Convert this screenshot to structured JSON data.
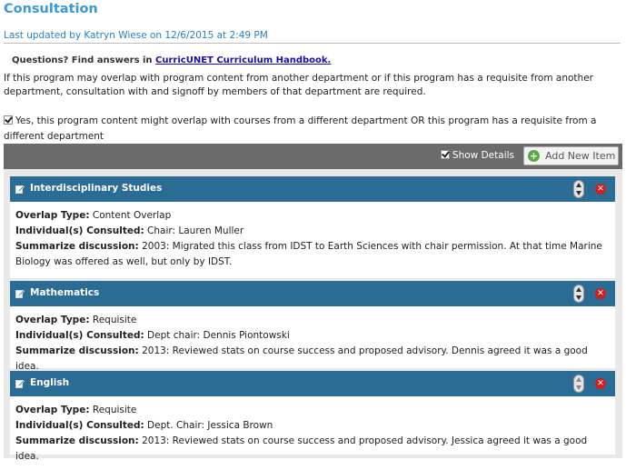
{
  "page": {
    "title": "Consultation",
    "last_updated": "Last updated by Katryn Wiese on 12/6/2015 at 2:49 PM",
    "questions_prefix": "Questions? Find answers in ",
    "handbook_link": "CurricUNET Curriculum Handbook.",
    "intro": "If this program may overlap with program content from another department or if this program has a requisite from another department, consultation with and signoff by members of that department are required.",
    "overlap_checkbox_label": "Yes, this program content might overlap with courses from a different department OR this program has a requisite from a different department",
    "overlap_checked": true
  },
  "toolbar": {
    "show_details_label": "Show Details",
    "show_details_checked": true,
    "add_new_item_label": "Add New Item"
  },
  "field_labels": {
    "overlap_type": "Overlap Type:",
    "individuals": "Individual(s) Consulted:",
    "summary": "Summarize discussion:"
  },
  "items": [
    {
      "title": "Interdisciplinary Studies",
      "overlap_type": "Content Overlap",
      "individuals": "Chair: Lauren Muller",
      "summary": "2003: Migrated this class from IDST to Earth Sciences with chair permission. At that time Marine Biology was offered as well, but only by IDST."
    },
    {
      "title": "Mathematics",
      "overlap_type": "Requisite",
      "individuals": "Dept chair: Dennis Piontowski",
      "summary": "2013: Reviewed stats on course success and proposed advisory. Dennis agreed it was a good idea."
    },
    {
      "title": "English",
      "overlap_type": "Requisite",
      "individuals": "Dept. Chair: Jessica Brown",
      "summary": "2013: Reviewed stats on course success and proposed advisory. Jessica agreed it was a good idea."
    }
  ],
  "icons": {
    "edit": "edit-icon",
    "move": "move-up-down-icon",
    "delete": "delete-icon",
    "add": "add-icon"
  },
  "colors": {
    "title": "#3a9ad9",
    "item_header": "#2b6c94",
    "toolbar": "#6b6b6b",
    "delete": "#d11f1f",
    "add": "#5aa943"
  }
}
